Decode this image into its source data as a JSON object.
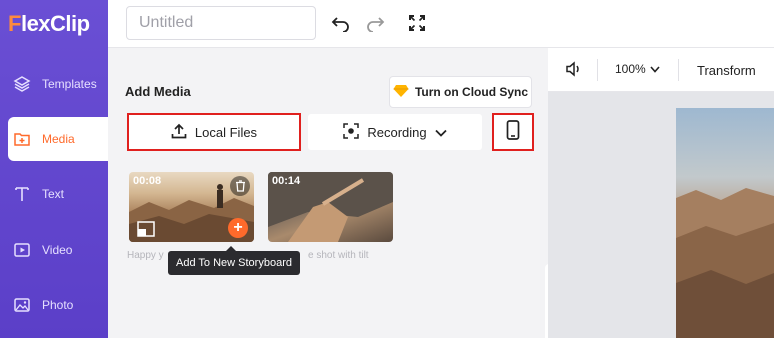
{
  "app": {
    "logo_text": "lexClip",
    "logo_initial": "F"
  },
  "sidebar": {
    "items": [
      {
        "label": "Templates",
        "icon": "layers-icon",
        "active": false
      },
      {
        "label": "Media",
        "icon": "folder-plus-icon",
        "active": true
      },
      {
        "label": "Text",
        "icon": "text-icon",
        "active": false
      },
      {
        "label": "Video",
        "icon": "video-icon",
        "active": false
      },
      {
        "label": "Photo",
        "icon": "photo-icon",
        "active": false
      }
    ]
  },
  "topbar": {
    "title_placeholder": "Untitled",
    "undo_icon": "undo-icon",
    "redo_icon": "redo-icon",
    "fullscreen_icon": "expand-icon"
  },
  "preview_toolbar": {
    "volume_icon": "volume-icon",
    "zoom": "100%",
    "transform_label": "Transform"
  },
  "media_panel": {
    "title": "Add Media",
    "cloud_sync_label": "Turn on Cloud Sync",
    "local_files_label": "Local Files",
    "recording_label": "Recording",
    "phone_icon": "phone-icon",
    "clips": [
      {
        "duration": "00:08",
        "caption": "Happy y"
      },
      {
        "duration": "00:14",
        "caption": "e shot with tilt"
      }
    ],
    "tooltip": "Add To New Storyboard",
    "collapse_icon": "‹"
  },
  "colors": {
    "sidebar": "#5b3fc8",
    "accent": "#ff6a2b",
    "highlight_border": "#e0201e"
  }
}
